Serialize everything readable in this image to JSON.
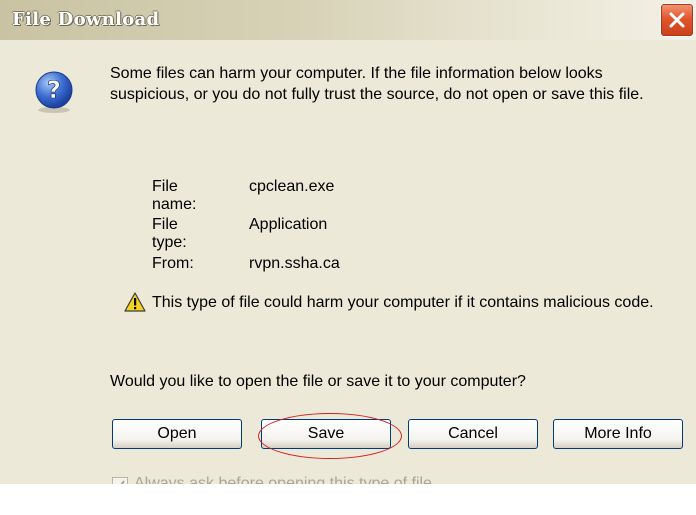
{
  "window": {
    "title": "File Download",
    "close_icon": "close-icon"
  },
  "message": {
    "icon": "question-icon",
    "intro_text": "Some files can harm your computer. If the file information below looks suspicious, or you do not fully trust the source, do not open or save this file."
  },
  "file_info": {
    "name_label": "File name:",
    "name_value": "cpclean.exe",
    "type_label": "File type:",
    "type_value": "Application",
    "from_label": "From:",
    "from_value": "rvpn.ssha.ca"
  },
  "warning": {
    "icon": "warning-icon",
    "text": "This type of file could harm your computer if it contains malicious code."
  },
  "prompt": "Would you like to open the file or save it to your computer?",
  "buttons": {
    "open": "Open",
    "save": "Save",
    "cancel": "Cancel",
    "more_info": "More Info"
  },
  "checkbox": {
    "label": "Always ask before opening this type of file",
    "checked": true,
    "disabled": true
  },
  "colors": {
    "highlight": "#d22020",
    "dialog_bg": "#ece9d8",
    "button_border": "#003c74"
  }
}
